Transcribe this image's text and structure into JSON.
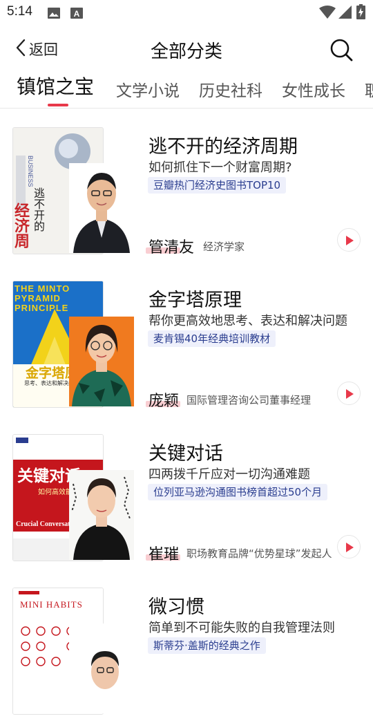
{
  "status_bar": {
    "time": "5:14",
    "icons": [
      "image-icon",
      "a-box-icon",
      "wifi-icon",
      "signal-icon",
      "battery-icon"
    ]
  },
  "nav": {
    "back_label": "返回",
    "title": "全部分类",
    "search_icon": "search-icon"
  },
  "tabs": [
    {
      "label": "镇馆之宝",
      "active": true
    },
    {
      "label": "文学小说",
      "active": false
    },
    {
      "label": "历史社科",
      "active": false
    },
    {
      "label": "女性成长",
      "active": false
    },
    {
      "label": "职",
      "active": false
    }
  ],
  "colors": {
    "accent": "#e8394a",
    "tag_bg": "#eef0fb",
    "tag_text": "#2a3d8f"
  },
  "books": [
    {
      "title": "逃不开的经济周期",
      "subtitle": "如何抓住下一个财富周期?",
      "tag": "豆瓣热门经济史图书TOP10",
      "author": "管清友",
      "role": "经济学家",
      "cover": {
        "big_text": "逃不开的",
        "big_red": "经济周期",
        "spine": "BUSINESS"
      }
    },
    {
      "title": "金字塔原理",
      "subtitle": "帮你更高效地思考、表达和解决问题",
      "tag": "麦肯锡40年经典培训教材",
      "author": "庞颖",
      "role": "国际管理咨询公司董事经理",
      "cover": {
        "top": "THE MINTO PYRAMID PRINCIPLE",
        "big_text": "金字塔原理",
        "sub": "思考、表达和解决问题的逻辑"
      }
    },
    {
      "title": "关键对话",
      "subtitle": "四两拨千斤应对一切沟通难题",
      "tag": "位列亚马逊沟通图书榜首超过50个月",
      "author": "崔璀",
      "role": "职场教育品牌“优势星球”发起人",
      "cover": {
        "big_text": "关键对话",
        "sub": "如何高效能沟通",
        "en": "Crucial Conversations"
      }
    },
    {
      "title": "微习惯",
      "subtitle": "简单到不可能失败的自我管理法则",
      "tag": "斯蒂芬·盖斯的经典之作",
      "author": "",
      "role": "",
      "cover": {
        "big_text": "MINI HABITS"
      }
    }
  ]
}
